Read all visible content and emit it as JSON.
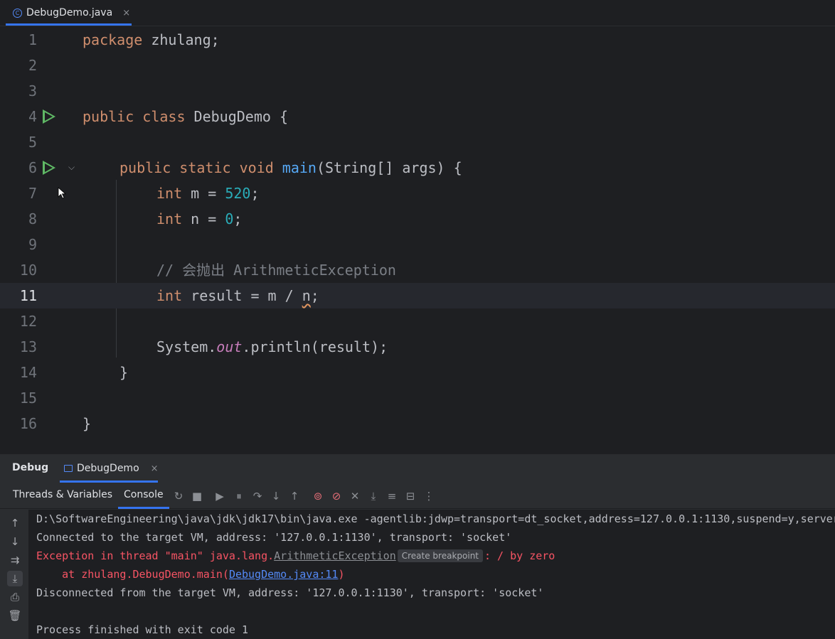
{
  "editor_tab": {
    "filename": "DebugDemo.java",
    "close": "×"
  },
  "editor": {
    "lines": [
      {
        "n": "1"
      },
      {
        "n": "2"
      },
      {
        "n": "3"
      },
      {
        "n": "4"
      },
      {
        "n": "5"
      },
      {
        "n": "6"
      },
      {
        "n": "7"
      },
      {
        "n": "8"
      },
      {
        "n": "9"
      },
      {
        "n": "10"
      },
      {
        "n": "11"
      },
      {
        "n": "12"
      },
      {
        "n": "13"
      },
      {
        "n": "14"
      },
      {
        "n": "15"
      },
      {
        "n": "16"
      }
    ],
    "code": {
      "l1_kw": "package",
      "l1_rest": " zhulang;",
      "l4_kw": "public class",
      "l4_rest": " DebugDemo {",
      "l6_kw": "public static void",
      "l6_fn": "main",
      "l6_rest": "(String[] args) {",
      "l7_kw": "int",
      "l7_mid": " m = ",
      "l7_num": "520",
      "l7_end": ";",
      "l8_kw": "int",
      "l8_mid": " n = ",
      "l8_num": "0",
      "l8_end": ";",
      "l10_cmt": "// 会抛出 ArithmeticException",
      "l11_kw": "int",
      "l11_mid": " result = m / ",
      "l11_var": "n",
      "l11_end": ";",
      "l13_a": "System.",
      "l13_static": "out",
      "l13_b": ".println(result);",
      "l14": "}",
      "l16": "}"
    },
    "current_line": 11
  },
  "debug": {
    "title": "Debug",
    "session_tab": "DebugDemo",
    "session_close": "×",
    "toolbar": {
      "threads_tab": "Threads & Variables",
      "console_tab": "Console"
    },
    "console": {
      "line1": "D:\\SoftwareEngineering\\java\\jdk\\jdk17\\bin\\java.exe -agentlib:jdwp=transport=dt_socket,address=127.0.0.1:1130,suspend=y,server",
      "line2": "Connected to the target VM, address: '127.0.0.1:1130', transport: 'socket'",
      "line3_a": "Exception in thread \"main\" java.lang.",
      "line3_link": "ArithmeticException",
      "line3_btn": "Create breakpoint",
      "line3_b": ": / by zero",
      "line4_a": "    at zhulang.DebugDemo.main(",
      "line4_link": "DebugDemo.java:11",
      "line4_b": ")",
      "line5": "Disconnected from the target VM, address: '127.0.0.1:1130', transport: 'socket'",
      "line6": "",
      "line7": "Process finished with exit code 1"
    }
  },
  "colors": {
    "background": "#1e1f22",
    "keyword": "#cf8e6d",
    "number": "#2aacb8",
    "function": "#56a8f5",
    "error": "#f75464",
    "run_icon": "#5fb865",
    "accent": "#3574f0"
  },
  "icons": [
    "java-class-icon",
    "run-gutter-icon",
    "fold-icon",
    "rerun-icon",
    "stop-icon",
    "resume-icon",
    "pause-icon",
    "step-over-icon",
    "step-into-icon",
    "step-out-icon",
    "view-breakpoints-icon",
    "mute-breakpoints-icon",
    "evaluate-icon",
    "run-to-cursor-icon",
    "frames-icon",
    "layout-icon",
    "more-icon",
    "scroll-up-icon",
    "scroll-down-icon",
    "soft-wrap-icon",
    "scroll-to-end-icon",
    "print-icon",
    "clear-icon"
  ]
}
